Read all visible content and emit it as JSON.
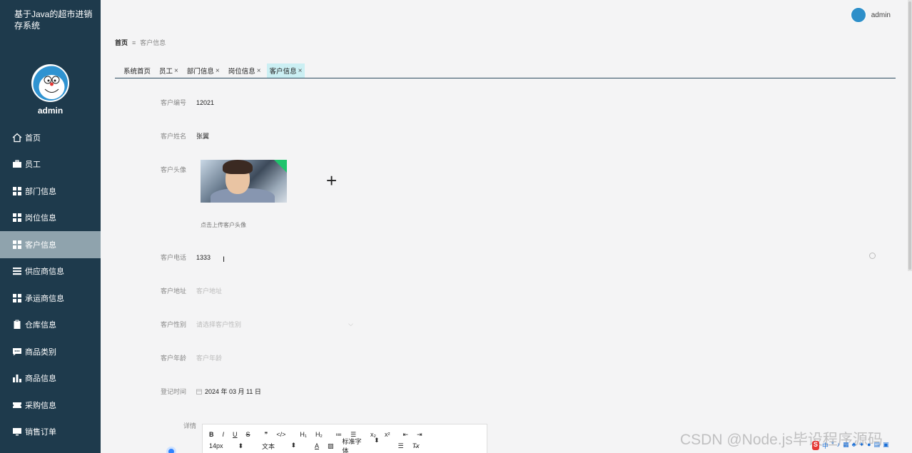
{
  "sidebar": {
    "title": "基于Java的超市进销存系统",
    "username": "admin",
    "items": [
      {
        "label": "首页",
        "icon": "home-icon"
      },
      {
        "label": "员工",
        "icon": "briefcase-icon"
      },
      {
        "label": "部门信息",
        "icon": "grid-icon"
      },
      {
        "label": "岗位信息",
        "icon": "grid-icon"
      },
      {
        "label": "客户信息",
        "icon": "grid-icon",
        "active": true
      },
      {
        "label": "供应商信息",
        "icon": "list-icon"
      },
      {
        "label": "承运商信息",
        "icon": "grid-icon"
      },
      {
        "label": "仓库信息",
        "icon": "clipboard-icon"
      },
      {
        "label": "商品类别",
        "icon": "chat-icon"
      },
      {
        "label": "商品信息",
        "icon": "bar-chart-icon"
      },
      {
        "label": "采购信息",
        "icon": "ticket-icon"
      },
      {
        "label": "销售订单",
        "icon": "monitor-icon"
      }
    ]
  },
  "header": {
    "username": "admin"
  },
  "breadcrumb": {
    "home": "首页",
    "separator": "≡",
    "current": "客户信息"
  },
  "tabs": [
    {
      "label": "系统首页",
      "closable": false
    },
    {
      "label": "员工",
      "closable": true
    },
    {
      "label": "部门信息",
      "closable": true
    },
    {
      "label": "岗位信息",
      "closable": true
    },
    {
      "label": "客户信息",
      "closable": true,
      "active": true
    }
  ],
  "form": {
    "customer_no": {
      "label": "客户编号",
      "value": "12021"
    },
    "customer_name": {
      "label": "客户姓名",
      "value": "张翼"
    },
    "customer_avatar": {
      "label": "客户头像",
      "hint": "点击上传客户头像"
    },
    "customer_phone": {
      "label": "客户电话",
      "value": "1333"
    },
    "customer_address": {
      "label": "客户地址",
      "placeholder": "客户地址"
    },
    "customer_gender": {
      "label": "客户性别",
      "placeholder": "请选择客户性别"
    },
    "customer_age": {
      "label": "客户年龄",
      "placeholder": "客户年龄"
    },
    "register_time": {
      "label": "登记时间",
      "value": "2024 年 03 月 11 日"
    },
    "details": {
      "label": "详情"
    }
  },
  "editor": {
    "row1": [
      "B",
      "I",
      "U",
      "S",
      "❞",
      "</>",
      "H₁",
      "H₂",
      "≔",
      "☰",
      "x₂",
      "x²",
      "⇤",
      "⇥"
    ],
    "font_size": "14px",
    "text_type": "文本",
    "font_family": "标准字体"
  },
  "watermark": "CSDN @Node.js毕设程序源码",
  "taskbar": [
    "S",
    "中",
    "°",
    "♪",
    "▦",
    "♣",
    "✦",
    "●",
    "▤",
    "▣"
  ]
}
